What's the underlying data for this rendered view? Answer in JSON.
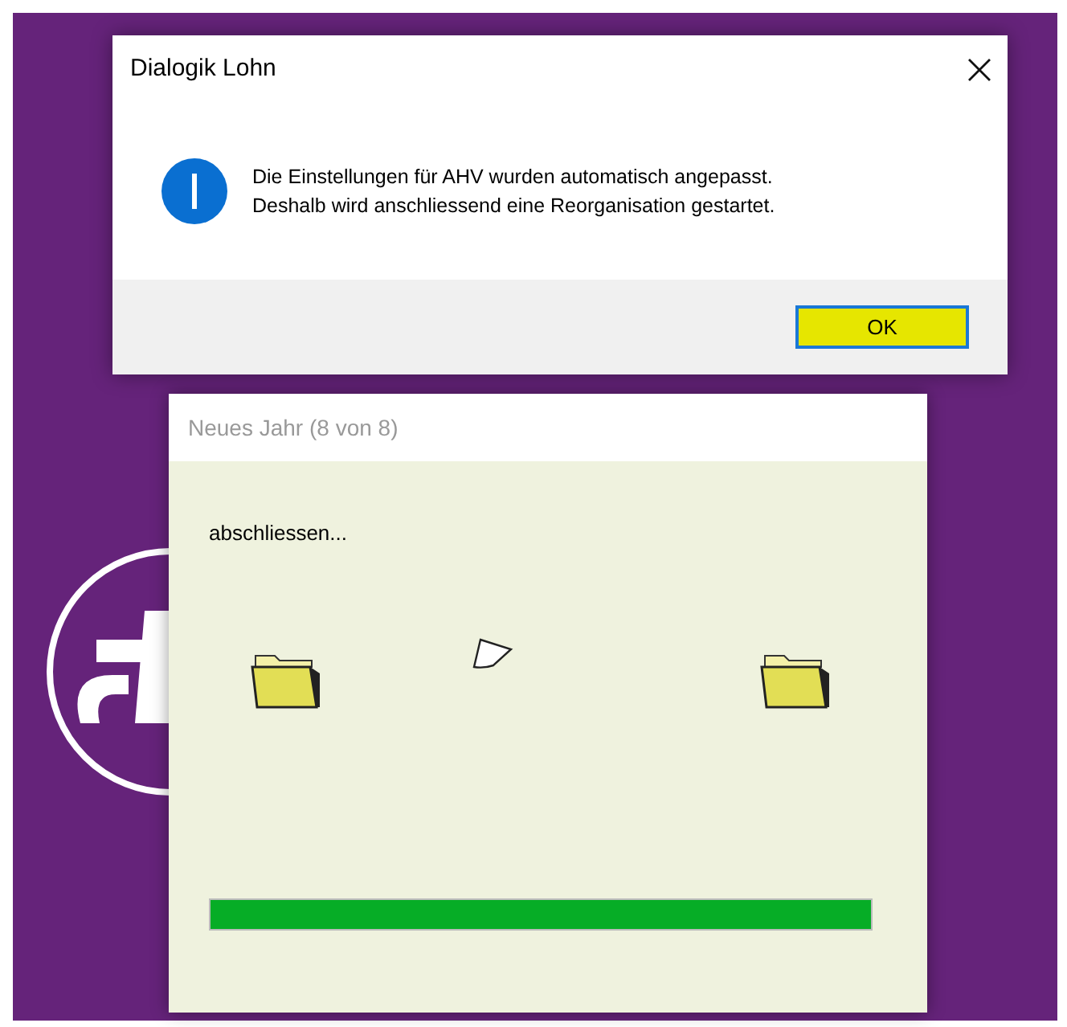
{
  "message_box": {
    "title": "Dialogik Lohn",
    "kind": "info",
    "lines": [
      "Die Einstellungen für AHV wurden automatisch angepasst.",
      "Deshalb wird anschliessend eine Reorganisation gestartet."
    ],
    "button": {
      "label": "OK",
      "highlighted": true
    }
  },
  "progress_window": {
    "title": "Neues Jahr (8 von 8)",
    "status": "abschliessen...",
    "progress": {
      "level": 1
    }
  }
}
